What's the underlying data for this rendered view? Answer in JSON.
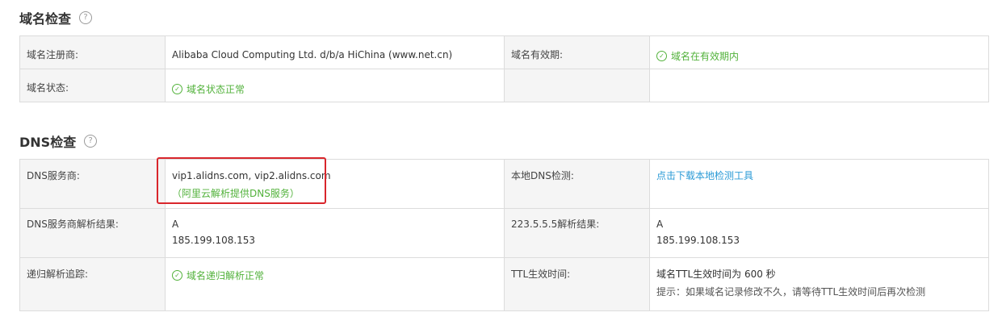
{
  "domain_section": {
    "title": "域名检查",
    "rows": [
      {
        "label1": "域名注册商:",
        "value1": "Alibaba Cloud Computing Ltd. d/b/a HiChina (www.net.cn)",
        "label2": "域名有效期:",
        "value2": "域名在有效期内"
      },
      {
        "label1": "域名状态:",
        "value1": "域名状态正常",
        "label2": "",
        "value2": ""
      }
    ]
  },
  "dns_section": {
    "title": "DNS检查",
    "provider_label": "DNS服务商:",
    "provider_value": "vip1.alidns.com, vip2.alidns.com",
    "provider_note": "（阿里云解析提供DNS服务）",
    "local_check_label": "本地DNS检测:",
    "local_check_link": "点击下载本地检测工具",
    "provider_result_label": "DNS服务商解析结果:",
    "provider_result_type": "A",
    "provider_result_ip": "185.199.108.153",
    "public_result_label": "223.5.5.5解析结果:",
    "public_result_type": "A",
    "public_result_ip": "185.199.108.153",
    "recursive_label": "递归解析追踪:",
    "recursive_value": "域名递归解析正常",
    "ttl_label": "TTL生效时间:",
    "ttl_value": "域名TTL生效时间为 600 秒",
    "ttl_tip": "提示：如果域名记录修改不久，请等待TTL生效时间后再次检测"
  },
  "icons": {
    "help": "question-circle-icon",
    "ok": "check-circle-icon"
  },
  "colors": {
    "ok_green": "#52b23b",
    "link_blue": "#2a9ad6",
    "highlight_red": "#d9262c"
  }
}
